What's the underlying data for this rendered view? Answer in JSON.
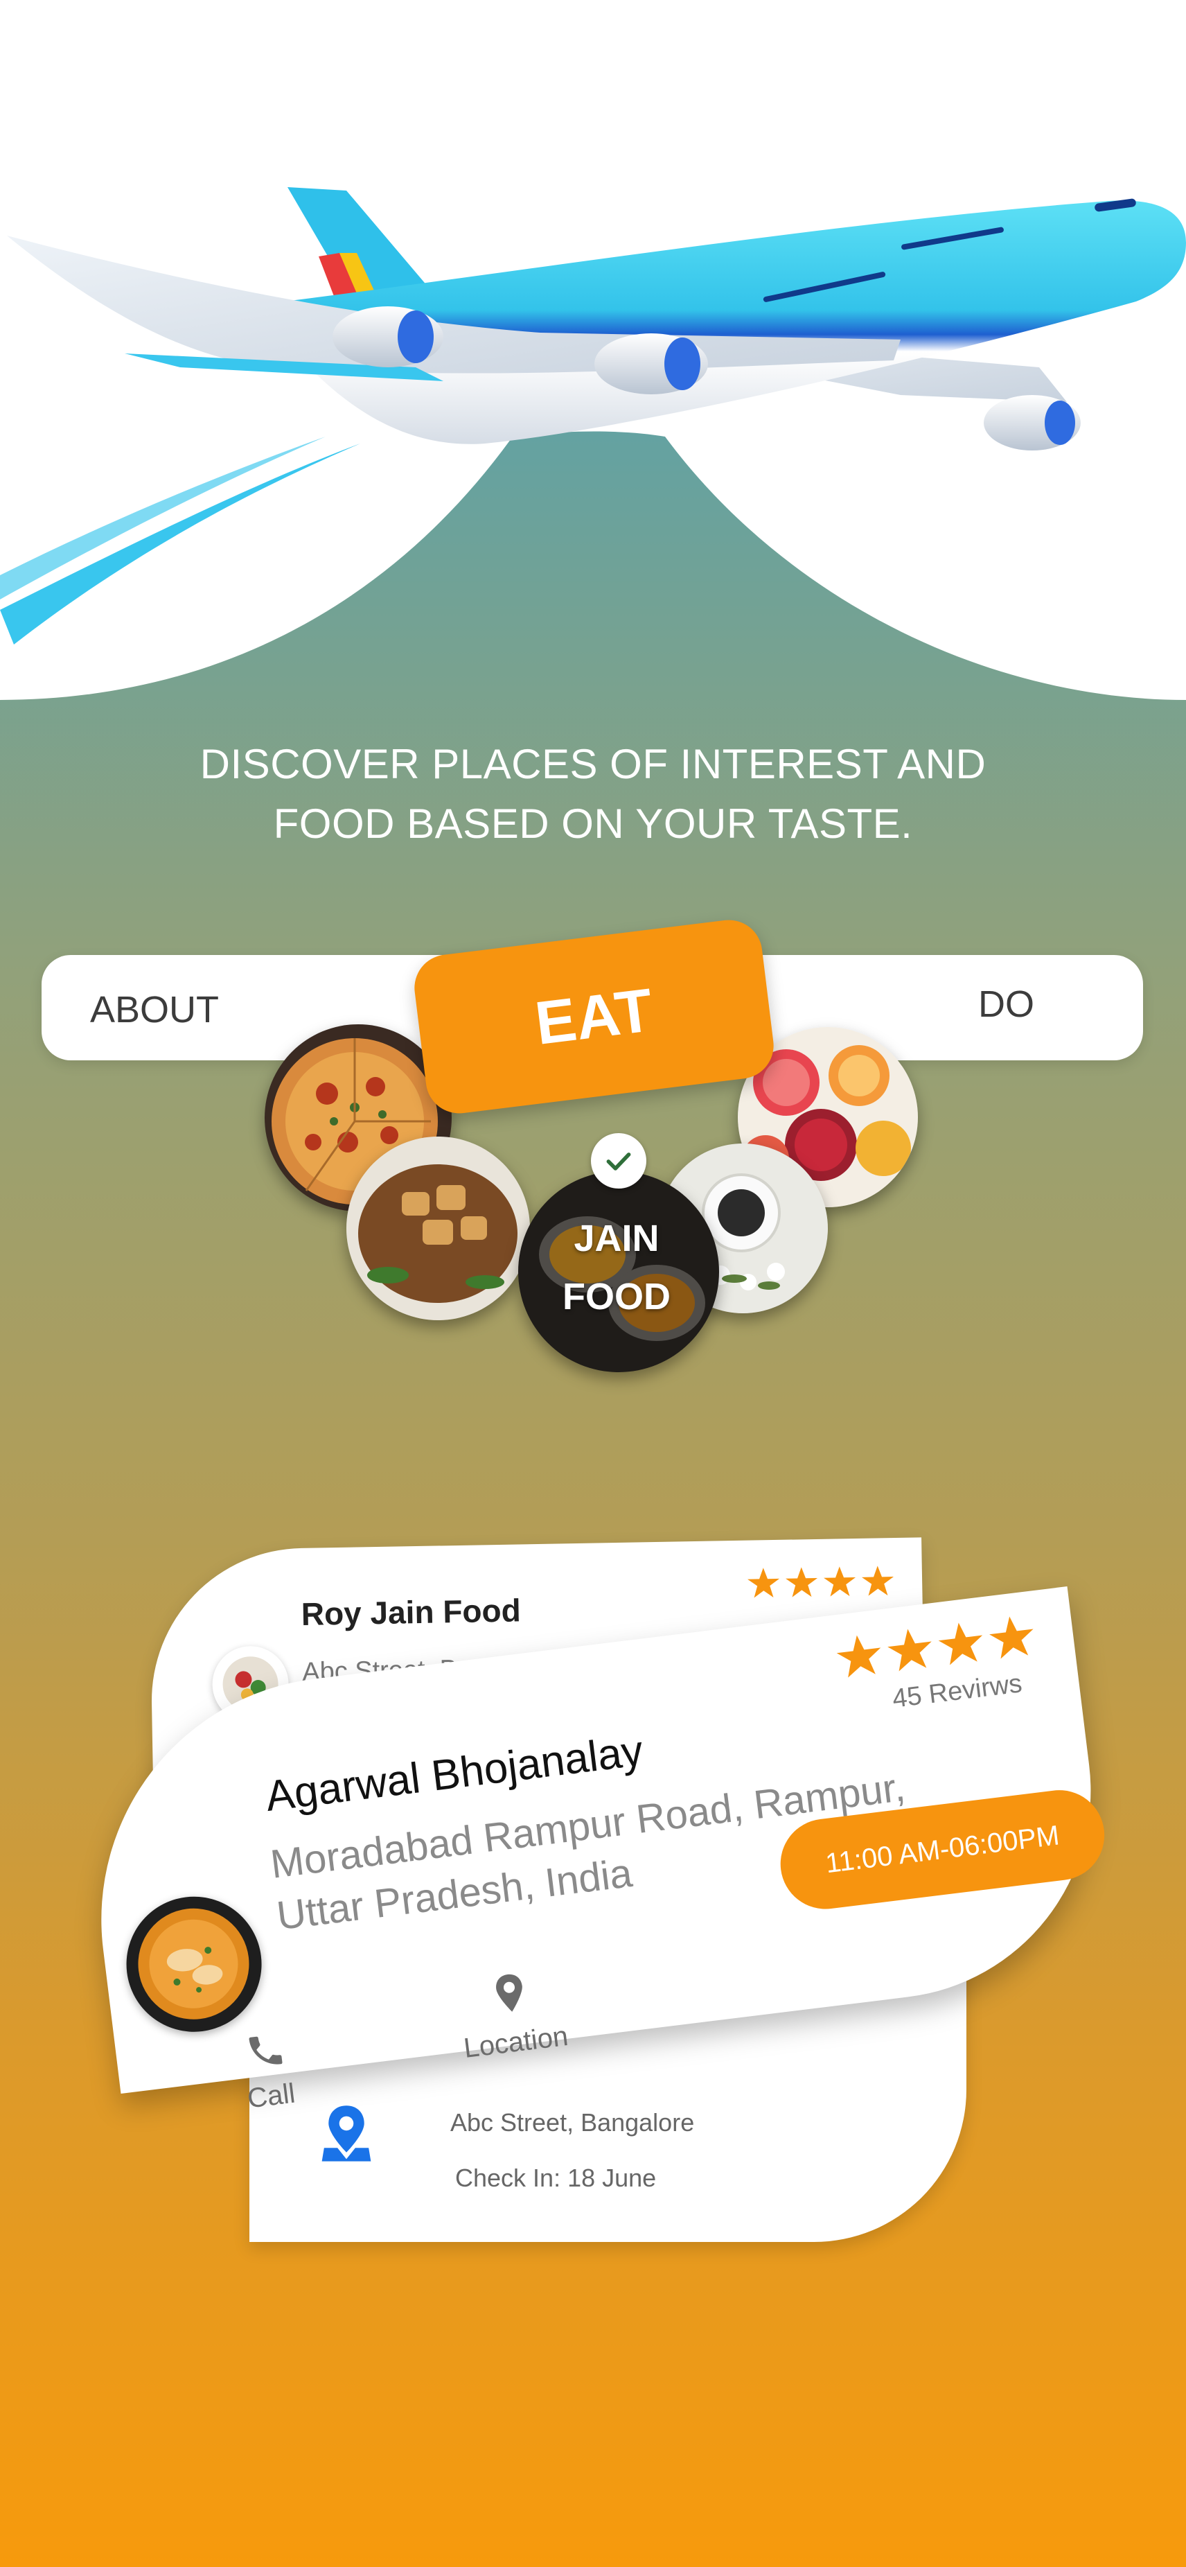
{
  "tagline": {
    "line1": "DISCOVER PLACES OF INTEREST AND",
    "line2": "FOOD BASED ON YOUR TASTE."
  },
  "tabs": {
    "about": "ABOUT",
    "eat": "EAT",
    "do": "DO"
  },
  "food_selector": {
    "selected_label_line1": "JAIN",
    "selected_label_line2": "FOOD"
  },
  "back_card_top": {
    "name": "Roy Jain Food",
    "address": "Abc Street, B"
  },
  "back_card_bottom": {
    "address": "Abc Street, Bangalore",
    "check_in": "Check In: 18 June"
  },
  "main_card": {
    "name": "Agarwal Bhojanalay",
    "reviews": "45 Revirws",
    "rating": 4,
    "address_line1": "Moradabad Rampur Road, Rampur,",
    "address_line2": "Uttar Pradesh, India",
    "hours": "11:00 AM-06:00PM",
    "call_label": "Call",
    "location_label": "Location"
  },
  "colors": {
    "accent": "#f7940f",
    "star": "#f7940f",
    "pin_blue": "#1a73e8",
    "text_dark": "#222222",
    "text_muted": "#777777"
  }
}
